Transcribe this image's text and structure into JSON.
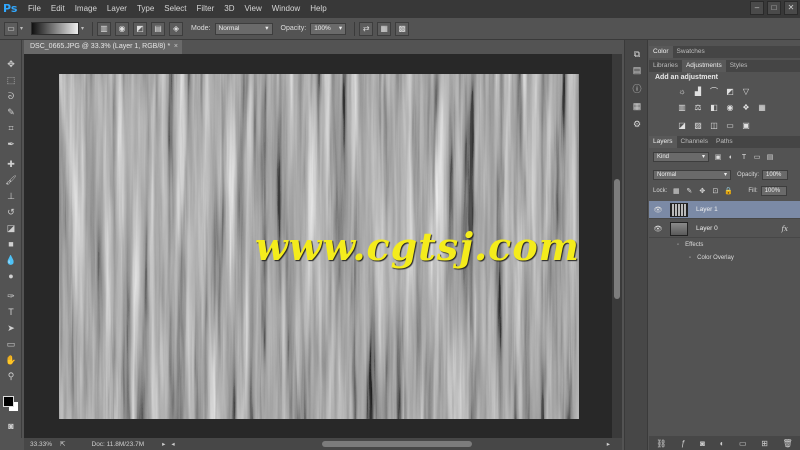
{
  "app": {
    "logo": "Ps",
    "menu": [
      "File",
      "Edit",
      "Image",
      "Layer",
      "Type",
      "Select",
      "Filter",
      "3D",
      "View",
      "Window",
      "Help"
    ],
    "window_controls": [
      "–",
      "□",
      "✕"
    ]
  },
  "options": {
    "mode_label": "Mode:",
    "mode_value": "Normal",
    "opacity_label": "Opacity:",
    "opacity_value": "100%"
  },
  "document": {
    "tab_title": "DSC_0665.JPG @ 33.3% (Layer 1, RGB/8) *",
    "tab_close": "×",
    "watermark": "www.cgtsj.com"
  },
  "status": {
    "zoom": "33.33%",
    "doc_info": "Doc: 11.8M/23.7M"
  },
  "panels": {
    "top_tabs": [
      "Color",
      "Swatches"
    ],
    "adj_tabs": [
      "Libraries",
      "Adjustments",
      "Styles"
    ],
    "adjust_heading": "Add an adjustment",
    "layer_tabs": [
      "Layers",
      "Channels",
      "Paths"
    ],
    "kind_filter": "Kind",
    "blend_mode": "Normal",
    "opacity_label": "Opacity:",
    "opacity_value": "100%",
    "lock_label": "Lock:",
    "fill_label": "Fill:",
    "fill_value": "100%"
  },
  "layers": [
    {
      "name": "Layer 1",
      "selected": true
    },
    {
      "name": "Layer 0",
      "selected": false,
      "fx": "fx"
    }
  ],
  "effects": {
    "group_label": "Effects",
    "items": [
      "Color Overlay"
    ]
  },
  "icons": {
    "toolbar": [
      "move-icon",
      "marquee-icon",
      "lasso-icon",
      "quick-select-icon",
      "crop-icon",
      "eyedropper-icon",
      "healing-icon",
      "brush-icon",
      "clone-stamp-icon",
      "history-brush-icon",
      "eraser-icon",
      "gradient-icon",
      "blur-icon",
      "dodge-icon",
      "pen-icon",
      "type-icon",
      "path-select-icon",
      "shape-icon",
      "hand-icon",
      "zoom-icon"
    ]
  }
}
